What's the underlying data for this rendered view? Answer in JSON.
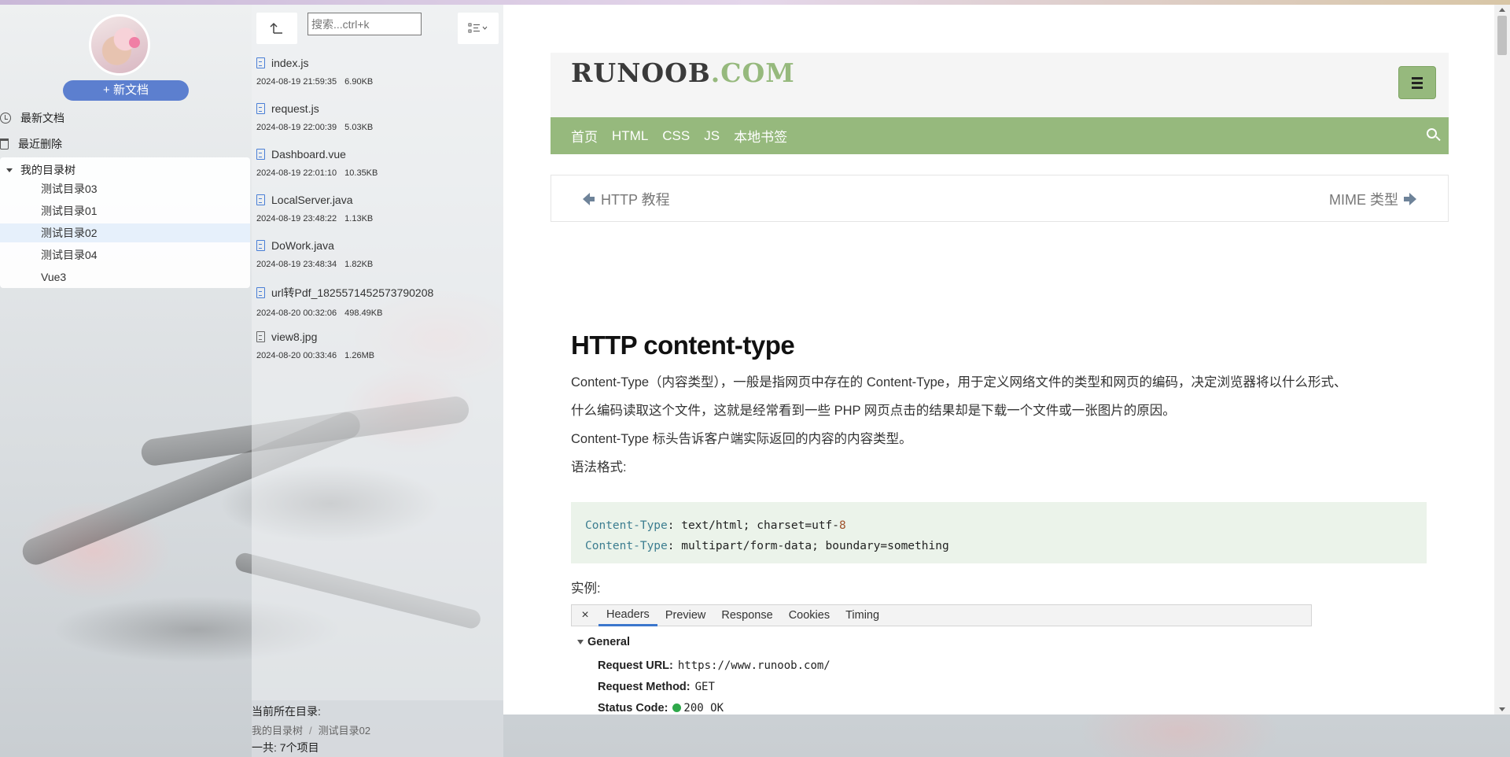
{
  "sidebar": {
    "new_doc_label": "+ 新文档",
    "menu": [
      {
        "label": "最新文档",
        "icon": "clock-icon"
      },
      {
        "label": "最近删除",
        "icon": "trash-icon"
      }
    ],
    "tree": {
      "root": "我的目录树",
      "nodes": [
        "测试目录03",
        "测试目录01",
        "测试目录02",
        "测试目录04",
        "Vue3"
      ],
      "active_index": 2
    }
  },
  "filelist": {
    "search_placeholder": "搜索...ctrl+k",
    "files": [
      {
        "name": "index.js",
        "time": "2024-08-19 21:59:35",
        "size": "6.90KB"
      },
      {
        "name": "request.js",
        "time": "2024-08-19 22:00:39",
        "size": "5.03KB"
      },
      {
        "name": "Dashboard.vue",
        "time": "2024-08-19 22:01:10",
        "size": "10.35KB"
      },
      {
        "name": "LocalServer.java",
        "time": "2024-08-19 23:48:22",
        "size": "1.13KB"
      },
      {
        "name": "DoWork.java",
        "time": "2024-08-19 23:48:34",
        "size": "1.82KB"
      },
      {
        "name": "url转Pdf_1825571452573790208",
        "time": "2024-08-20 00:32:06",
        "size": "498.49KB"
      },
      {
        "name": "view8.jpg",
        "time": "2024-08-20 00:33:46",
        "size": "1.26MB"
      }
    ],
    "footer": {
      "current_dir_label": "当前所在目录:",
      "breadcrumb": [
        "我的目录树",
        "测试目录02"
      ],
      "total": "一共: 7个项目"
    }
  },
  "content": {
    "logo_main": "RUNOOB",
    "logo_suffix": ".COM",
    "nav": [
      "首页",
      "HTML",
      "CSS",
      "JS",
      "本地书签"
    ],
    "prev": "HTTP 教程",
    "next": "MIME 类型",
    "title": "HTTP content-type",
    "p1a": "Content-Type（内容类型），一般是指网页中存在的 Content-Type，用于定义网络文件的类型和网页的编码，决定浏览器将以什么形式、",
    "p1b": "什么编码读取这个文件，这就是经常看到一些 PHP 网页点击的结果却是下载一个文件或一张图片的原因。",
    "p2": "Content-Type 标头告诉客户端实际返回的内容的内容类型。",
    "p3": "语法格式:",
    "code": [
      {
        "key": "Content-Type",
        "rest_a": ": text/html; charset=utf-",
        "num": "8",
        "rest_b": ""
      },
      {
        "key": "Content-Type",
        "rest_a": ": multipart/form-data; boundary=something",
        "num": "",
        "rest_b": ""
      }
    ],
    "example_label": "实例:",
    "devtools": {
      "close": "×",
      "tabs": [
        "Headers",
        "Preview",
        "Response",
        "Cookies",
        "Timing"
      ],
      "active_tab": 0,
      "section": "General",
      "rows": [
        {
          "label": "Request URL:",
          "value": "https://www.runoob.com/"
        },
        {
          "label": "Request Method:",
          "value": "GET"
        },
        {
          "label": "Status Code:",
          "value": "200 OK"
        }
      ]
    }
  },
  "colors": {
    "accent_green": "#96b97d",
    "new_doc_blue": "#5c7fcf",
    "file_icon_blue": "#4a7fd6",
    "status_green": "#2ea84a"
  }
}
